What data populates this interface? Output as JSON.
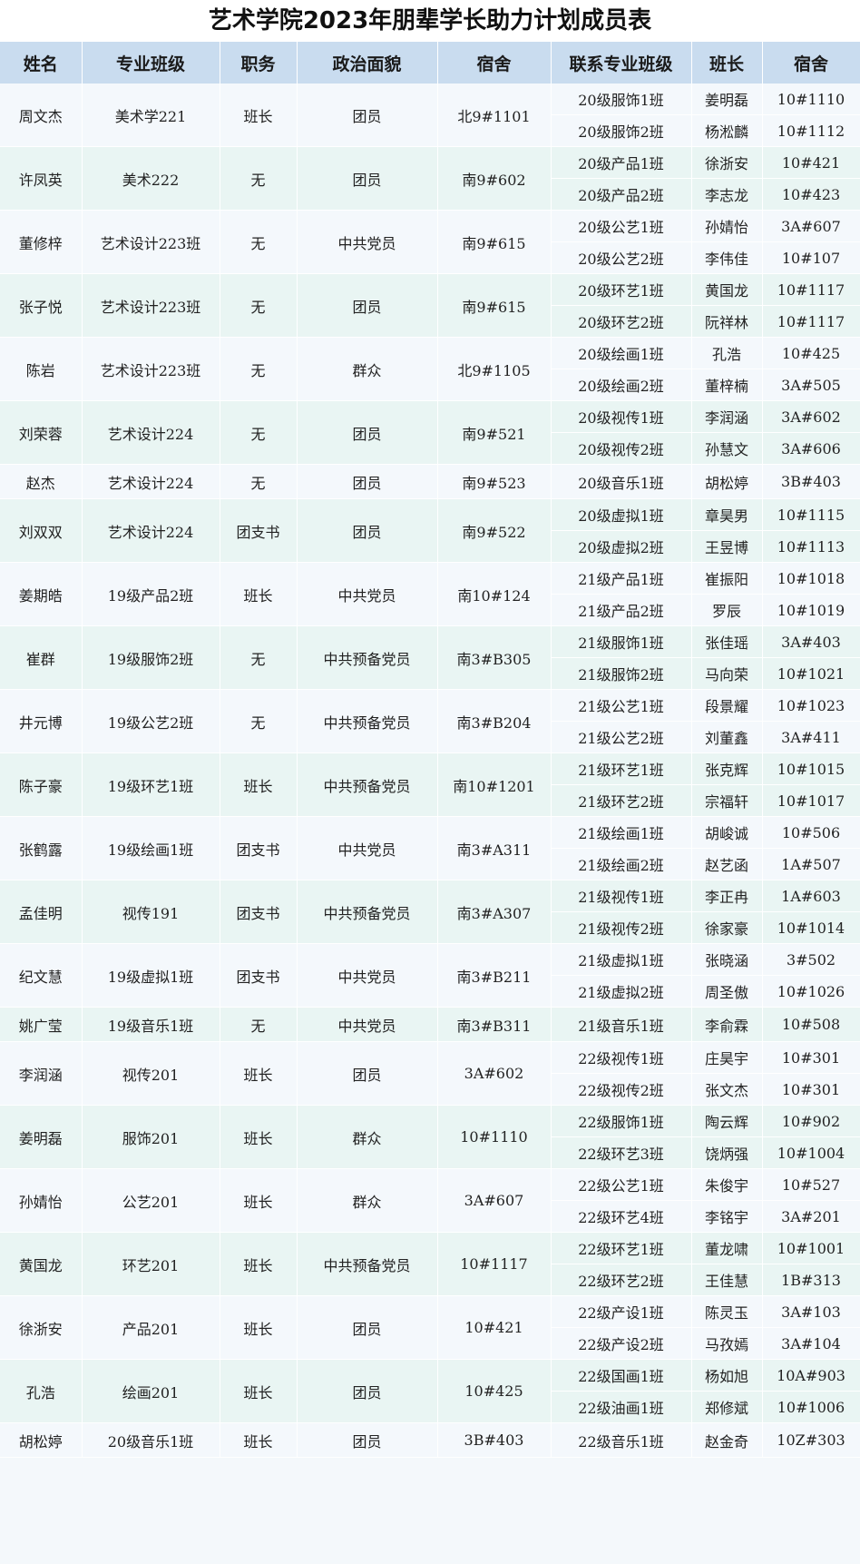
{
  "title": "艺术学院2023年朋辈学长助力计划成员表",
  "headers": [
    "姓名",
    "专业班级",
    "职务",
    "政治面貌",
    "宿舍",
    "联系专业班级",
    "班长",
    "宿舍"
  ],
  "rows": [
    {
      "name": "周文杰",
      "major": "美术学221",
      "role": "班长",
      "political": "团员",
      "dorm": "北9#1101",
      "contacts": [
        {
          "class": "20级服饰1班",
          "monitor": "姜明磊",
          "dorm": "10#1110"
        },
        {
          "class": "20级服饰2班",
          "monitor": "杨淞麟",
          "dorm": "10#1112"
        }
      ]
    },
    {
      "name": "许凤英",
      "major": "美术222",
      "role": "无",
      "political": "团员",
      "dorm": "南9#602",
      "contacts": [
        {
          "class": "20级产品1班",
          "monitor": "徐浙安",
          "dorm": "10#421"
        },
        {
          "class": "20级产品2班",
          "monitor": "李志龙",
          "dorm": "10#423"
        }
      ]
    },
    {
      "name": "董修梓",
      "major": "艺术设计223班",
      "role": "无",
      "political": "中共党员",
      "dorm": "南9#615",
      "contacts": [
        {
          "class": "20级公艺1班",
          "monitor": "孙婧怡",
          "dorm": "3A#607"
        },
        {
          "class": "20级公艺2班",
          "monitor": "李伟佳",
          "dorm": "10#107"
        }
      ]
    },
    {
      "name": "张子悦",
      "major": "艺术设计223班",
      "role": "无",
      "political": "团员",
      "dorm": "南9#615",
      "contacts": [
        {
          "class": "20级环艺1班",
          "monitor": "黄国龙",
          "dorm": "10#1117"
        },
        {
          "class": "20级环艺2班",
          "monitor": "阮祥林",
          "dorm": "10#1117"
        }
      ]
    },
    {
      "name": "陈岩",
      "major": "艺术设计223班",
      "role": "无",
      "political": "群众",
      "dorm": "北9#1105",
      "contacts": [
        {
          "class": "20级绘画1班",
          "monitor": "孔浩",
          "dorm": "10#425"
        },
        {
          "class": "20级绘画2班",
          "monitor": "董梓楠",
          "dorm": "3A#505"
        }
      ]
    },
    {
      "name": "刘荣蓉",
      "major": "艺术设计224",
      "role": "无",
      "political": "团员",
      "dorm": "南9#521",
      "contacts": [
        {
          "class": "20级视传1班",
          "monitor": "李润涵",
          "dorm": "3A#602"
        },
        {
          "class": "20级视传2班",
          "monitor": "孙慧文",
          "dorm": "3A#606"
        }
      ]
    },
    {
      "name": "赵杰",
      "major": "艺术设计224",
      "role": "无",
      "political": "团员",
      "dorm": "南9#523",
      "contacts": [
        {
          "class": "20级音乐1班",
          "monitor": "胡松婷",
          "dorm": "3B#403"
        }
      ]
    },
    {
      "name": "刘双双",
      "major": "艺术设计224",
      "role": "团支书",
      "political": "团员",
      "dorm": "南9#522",
      "contacts": [
        {
          "class": "20级虚拟1班",
          "monitor": "章昊男",
          "dorm": "10#1115"
        },
        {
          "class": "20级虚拟2班",
          "monitor": "王昱博",
          "dorm": "10#1113"
        }
      ]
    },
    {
      "name": "姜期皓",
      "major": "19级产品2班",
      "role": "班长",
      "political": "中共党员",
      "dorm": "南10#124",
      "contacts": [
        {
          "class": "21级产品1班",
          "monitor": "崔振阳",
          "dorm": "10#1018"
        },
        {
          "class": "21级产品2班",
          "monitor": "罗辰",
          "dorm": "10#1019"
        }
      ]
    },
    {
      "name": "崔群",
      "major": "19级服饰2班",
      "role": "无",
      "political": "中共预备党员",
      "dorm": "南3#B305",
      "contacts": [
        {
          "class": "21级服饰1班",
          "monitor": "张佳瑶",
          "dorm": "3A#403"
        },
        {
          "class": "21级服饰2班",
          "monitor": "马向荣",
          "dorm": "10#1021"
        }
      ]
    },
    {
      "name": "井元博",
      "major": "19级公艺2班",
      "role": "无",
      "political": "中共预备党员",
      "dorm": "南3#B204",
      "contacts": [
        {
          "class": "21级公艺1班",
          "monitor": "段景耀",
          "dorm": "10#1023"
        },
        {
          "class": "21级公艺2班",
          "monitor": "刘董鑫",
          "dorm": "3A#411"
        }
      ]
    },
    {
      "name": "陈子豪",
      "major": "19级环艺1班",
      "role": "班长",
      "political": "中共预备党员",
      "dorm": "南10#1201",
      "contacts": [
        {
          "class": "21级环艺1班",
          "monitor": "张克辉",
          "dorm": "10#1015"
        },
        {
          "class": "21级环艺2班",
          "monitor": "宗福轩",
          "dorm": "10#1017"
        }
      ]
    },
    {
      "name": "张鹤露",
      "major": "19级绘画1班",
      "role": "团支书",
      "political": "中共党员",
      "dorm": "南3#A311",
      "contacts": [
        {
          "class": "21级绘画1班",
          "monitor": "胡峻诚",
          "dorm": "10#506"
        },
        {
          "class": "21级绘画2班",
          "monitor": "赵艺函",
          "dorm": "1A#507"
        }
      ]
    },
    {
      "name": "孟佳明",
      "major": "视传191",
      "role": "团支书",
      "political": "中共预备党员",
      "dorm": "南3#A307",
      "contacts": [
        {
          "class": "21级视传1班",
          "monitor": "李正冉",
          "dorm": "1A#603"
        },
        {
          "class": "21级视传2班",
          "monitor": "徐家豪",
          "dorm": "10#1014"
        }
      ]
    },
    {
      "name": "纪文慧",
      "major": "19级虚拟1班",
      "role": "团支书",
      "political": "中共党员",
      "dorm": "南3#B211",
      "contacts": [
        {
          "class": "21级虚拟1班",
          "monitor": "张晓涵",
          "dorm": "3#502"
        },
        {
          "class": "21级虚拟2班",
          "monitor": "周圣傲",
          "dorm": "10#1026"
        }
      ]
    },
    {
      "name": "姚广莹",
      "major": "19级音乐1班",
      "role": "无",
      "political": "中共党员",
      "dorm": "南3#B311",
      "contacts": [
        {
          "class": "21级音乐1班",
          "monitor": "李俞霖",
          "dorm": "10#508"
        }
      ]
    },
    {
      "name": "李润涵",
      "major": "视传201",
      "role": "班长",
      "political": "团员",
      "dorm": "3A#602",
      "contacts": [
        {
          "class": "22级视传1班",
          "monitor": "庄昊宇",
          "dorm": "10#301"
        },
        {
          "class": "22级视传2班",
          "monitor": "张文杰",
          "dorm": "10#301"
        }
      ]
    },
    {
      "name": "姜明磊",
      "major": "服饰201",
      "role": "班长",
      "political": "群众",
      "dorm": "10#1110",
      "contacts": [
        {
          "class": "22级服饰1班",
          "monitor": "陶云辉",
          "dorm": "10#902"
        },
        {
          "class": "22级环艺3班",
          "monitor": "饶炳强",
          "dorm": "10#1004"
        }
      ]
    },
    {
      "name": "孙婧怡",
      "major": "公艺201",
      "role": "班长",
      "political": "群众",
      "dorm": "3A#607",
      "contacts": [
        {
          "class": "22级公艺1班",
          "monitor": "朱俊宇",
          "dorm": "10#527"
        },
        {
          "class": "22级环艺4班",
          "monitor": "李铭宇",
          "dorm": "3A#201"
        }
      ]
    },
    {
      "name": "黄国龙",
      "major": "环艺201",
      "role": "班长",
      "political": "中共预备党员",
      "dorm": "10#1117",
      "contacts": [
        {
          "class": "22级环艺1班",
          "monitor": "董龙啸",
          "dorm": "10#1001"
        },
        {
          "class": "22级环艺2班",
          "monitor": "王佳慧",
          "dorm": "1B#313"
        }
      ]
    },
    {
      "name": "徐浙安",
      "major": "产品201",
      "role": "班长",
      "political": "团员",
      "dorm": "10#421",
      "contacts": [
        {
          "class": "22级产设1班",
          "monitor": "陈灵玉",
          "dorm": "3A#103"
        },
        {
          "class": "22级产设2班",
          "monitor": "马孜嫣",
          "dorm": "3A#104"
        }
      ]
    },
    {
      "name": "孔浩",
      "major": "绘画201",
      "role": "班长",
      "political": "团员",
      "dorm": "10#425",
      "contacts": [
        {
          "class": "22级国画1班",
          "monitor": "杨如旭",
          "dorm": "10A#903"
        },
        {
          "class": "22级油画1班",
          "monitor": "郑修斌",
          "dorm": "10#1006"
        }
      ]
    },
    {
      "name": "胡松婷",
      "major": "20级音乐1班",
      "role": "班长",
      "political": "团员",
      "dorm": "3B#403",
      "contacts": [
        {
          "class": "22级音乐1班",
          "monitor": "赵金奇",
          "dorm": "10Z#303"
        }
      ]
    }
  ]
}
